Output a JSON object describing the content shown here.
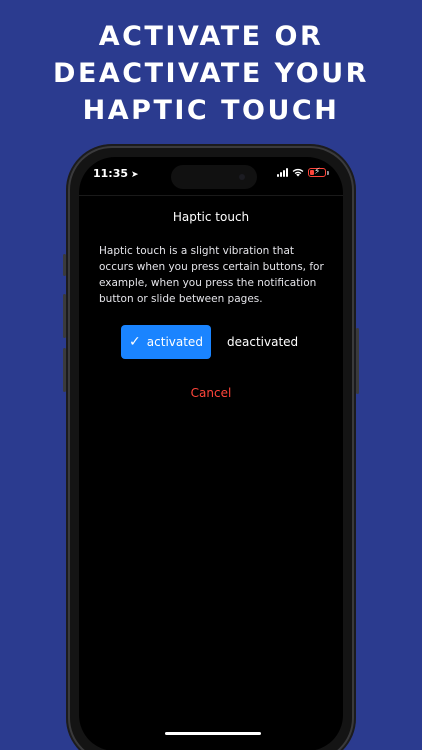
{
  "headline": {
    "line1": "ACTIVATE OR",
    "line2": "DEACTIVATE YOUR",
    "line3": "HAPTIC TOUCH"
  },
  "status_bar": {
    "time": "11:35",
    "location_icon": "location-arrow-icon",
    "signal_icon": "cellular-signal-icon",
    "wifi_icon": "wifi-icon",
    "battery_icon": "battery-low-charging-icon",
    "battery_color": "#ff453a"
  },
  "dialog": {
    "title": "Haptic touch",
    "description": "Haptic touch is a slight vibration that occurs when you press certain buttons, for example, when you press the notification button or slide between pages.",
    "options": {
      "activated_label": "activated",
      "deactivated_label": "deactivated",
      "selected": "activated",
      "check_icon": "checkmark-icon"
    },
    "cancel_label": "Cancel"
  },
  "colors": {
    "background": "#2b3b8f",
    "accent": "#1a84ff",
    "destructive": "#ff453a",
    "screen": "#000000"
  }
}
